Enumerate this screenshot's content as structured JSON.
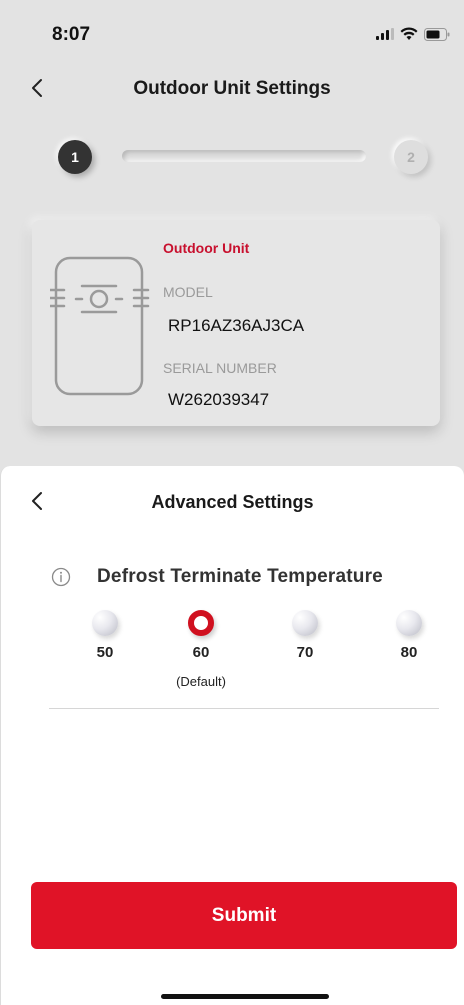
{
  "status_bar": {
    "time": "8:07"
  },
  "header": {
    "title": "Outdoor Unit Settings"
  },
  "stepper": {
    "steps": [
      "1",
      "2"
    ],
    "current": 1
  },
  "unit_card": {
    "type_label": "Outdoor Unit",
    "model_label": "MODEL",
    "model_value": "RP16AZ36AJ3CA",
    "serial_label": "SERIAL NUMBER",
    "serial_value": "W262039347"
  },
  "sheet": {
    "title": "Advanced Settings",
    "setting_label": "Defrost Terminate Temperature",
    "options": [
      {
        "value": "50",
        "selected": false
      },
      {
        "value": "60",
        "selected": true
      },
      {
        "value": "70",
        "selected": false
      },
      {
        "value": "80",
        "selected": false
      }
    ],
    "default_note": "(Default)",
    "submit_label": "Submit"
  },
  "colors": {
    "accent": "#e01327",
    "selected_radio": "#d0101f",
    "unit_type": "#c8102e"
  },
  "icons": [
    "back-chevron-icon",
    "info-icon",
    "outdoor-unit-icon",
    "signal-icon",
    "wifi-icon",
    "battery-icon"
  ]
}
